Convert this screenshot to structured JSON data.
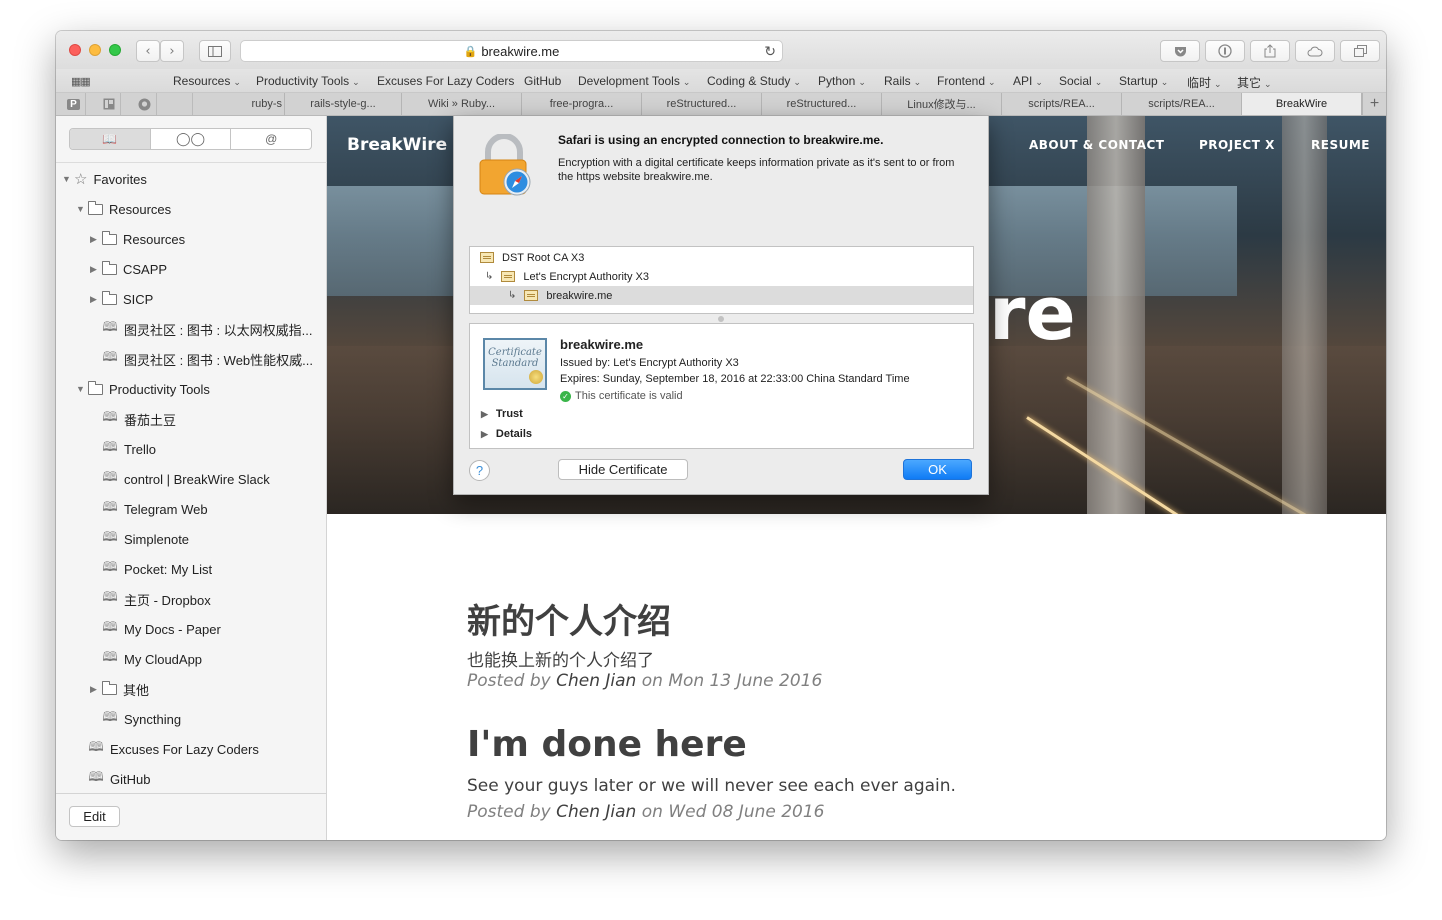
{
  "browser": {
    "address": "breakwire.me",
    "bookmarks": [
      "Resources",
      "Productivity Tools",
      "Excuses For Lazy Coders",
      "GitHub",
      "Development Tools",
      "Coding & Study",
      "Python",
      "Rails",
      "Frontend",
      "API",
      "Social",
      "Startup",
      "临时",
      "其它"
    ],
    "tabs": [
      "ruby-s",
      "rails-style-g...",
      "Wiki » Ruby...",
      "free-progra...",
      "reStructured...",
      "reStructured...",
      "Linux修改与...",
      "scripts/REA...",
      "scripts/REA...",
      "BreakWire"
    ],
    "pinned_tabs": [
      "P",
      "Instapaper",
      "GitHub"
    ]
  },
  "sidebar": {
    "segments": [
      "bookmarks",
      "reading-list",
      "shared-links"
    ],
    "items": [
      {
        "label": "Favorites"
      },
      {
        "label": "Resources"
      },
      {
        "label": "Resources"
      },
      {
        "label": "CSAPP"
      },
      {
        "label": "SICP"
      },
      {
        "label": "图灵社区 : 图书 : 以太网权威指..."
      },
      {
        "label": "图灵社区 : 图书 : Web性能权威..."
      },
      {
        "label": "Productivity Tools"
      },
      {
        "label": "番茄土豆"
      },
      {
        "label": "Trello"
      },
      {
        "label": "control | BreakWire Slack"
      },
      {
        "label": "Telegram Web"
      },
      {
        "label": "Simplenote"
      },
      {
        "label": "Pocket: My List"
      },
      {
        "label": "主页 - Dropbox"
      },
      {
        "label": "My Docs - Paper"
      },
      {
        "label": "My CloudApp"
      },
      {
        "label": "其他"
      },
      {
        "label": "Syncthing"
      },
      {
        "label": "Excuses For Lazy Coders"
      },
      {
        "label": "GitHub"
      }
    ],
    "edit_label": "Edit"
  },
  "site": {
    "brand": "BreakWire",
    "nav": [
      "ABOUT & CONTACT",
      "PROJECT X",
      "RESUME"
    ],
    "hero_fragment": "re",
    "posts": [
      {
        "title": "新的个人介绍",
        "subtitle": "也能换上新的个人介绍了",
        "meta_prefix": "Posted by",
        "author": "Chen Jian",
        "meta_on": "on",
        "date": "Mon 13 June 2016"
      },
      {
        "title": "I'm done here",
        "subtitle": "See your guys later or we will never see each ever again.",
        "meta_prefix": "Posted by",
        "author": "Chen Jian",
        "meta_on": "on",
        "date": "Wed 08 June 2016"
      }
    ]
  },
  "dialog": {
    "title": "Safari is using an encrypted connection to breakwire.me.",
    "message": "Encryption with a digital certificate keeps information private as it's sent to or from the https website breakwire.me.",
    "chain": [
      "DST Root CA X3",
      "Let's Encrypt Authority X3",
      "breakwire.me"
    ],
    "cert_name": "breakwire.me",
    "issued_by": "Issued by: Let's Encrypt Authority X3",
    "expires": "Expires: Sunday, September 18, 2016 at 22:33:00 China Standard Time",
    "valid_text": "This certificate is valid",
    "trust_label": "Trust",
    "details_label": "Details",
    "cert_image_text": "Certificate Standard",
    "help_label": "?",
    "hide_label": "Hide Certificate",
    "ok_label": "OK"
  },
  "colors": {
    "ok_button": "#0f7bf5",
    "valid_check": "#3ab54a"
  }
}
